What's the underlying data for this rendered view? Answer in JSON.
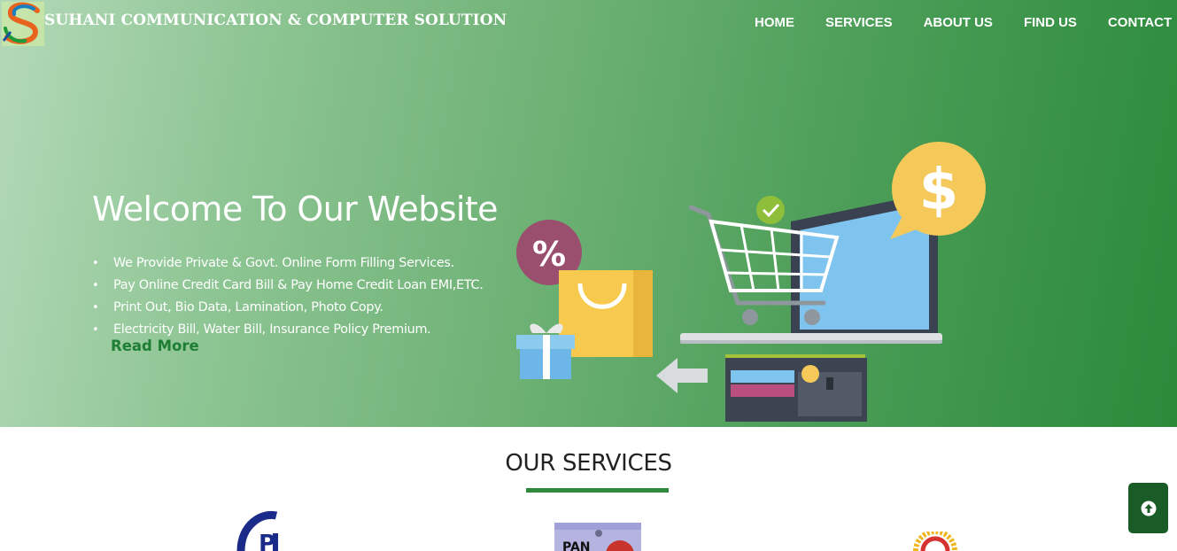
{
  "header": {
    "brand": "SUHANI COMMUNICATION & COMPUTER SOLUTION",
    "logo_icon": "brand-logo-s"
  },
  "nav": {
    "items": [
      {
        "label": "HOME"
      },
      {
        "label": "SERVICES"
      },
      {
        "label": "ABOUT US"
      },
      {
        "label": "FIND US"
      },
      {
        "label": "CONTACT"
      }
    ]
  },
  "hero": {
    "title": "Welcome To Our Website",
    "bullets": [
      "We Provide Private & Govt. Online Form Filling Services.",
      "Pay Online Credit Card Bill & Pay Home Credit Loan EMI,ETC.",
      "Print Out, Bio Data, Lamination, Photo Copy.",
      "Electricity Bill, Water Bill, Insurance Policy Premium."
    ],
    "read_more": "Read More",
    "illustration_icons": [
      "percent-badge-icon",
      "shopping-bag-icon",
      "gift-box-icon",
      "shopping-cart-icon",
      "check-icon",
      "laptop-icon",
      "dollar-bubble-icon",
      "arrow-left-icon",
      "wallet-icon"
    ]
  },
  "services": {
    "heading": "OUR SERVICES",
    "icons": [
      "ipb-logo-icon",
      "pan-card-icon",
      "aadhaar-logo-icon"
    ],
    "pan_text": "PAN"
  },
  "colors": {
    "accent_green": "#2e8b3e",
    "read_more": "#1e7e34",
    "scroll_button": "#1a5c27"
  },
  "scroll_top": {
    "icon": "arrow-up-icon"
  }
}
